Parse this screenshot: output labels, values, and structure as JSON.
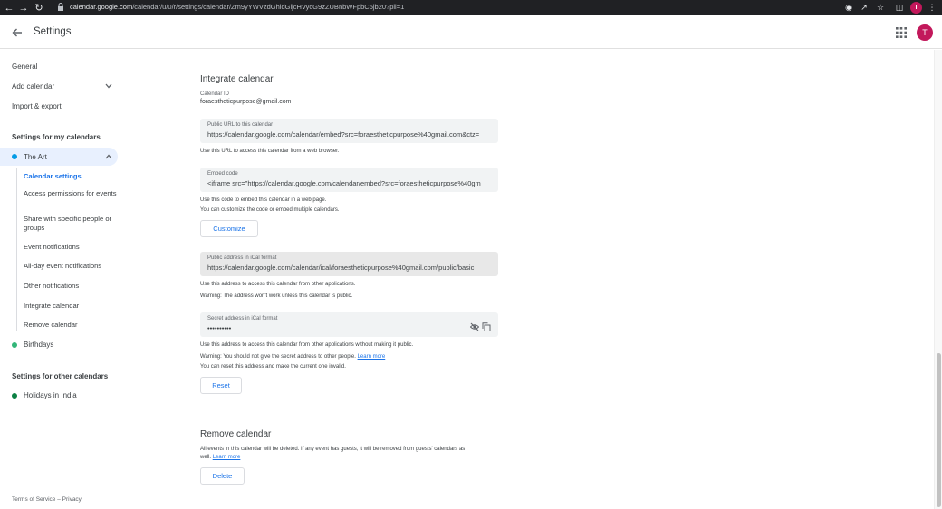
{
  "browser": {
    "url_host": "calendar.google.com",
    "url_path": "/calendar/u/0/r/settings/calendar/Zm9yYWVzdGhldGljcHVycG9zZUBnbWFpbC5jb20?pli=1",
    "profile_initial": "T"
  },
  "header": {
    "title": "Settings",
    "avatar_initial": "T"
  },
  "sidebar": {
    "general": "General",
    "add_calendar": "Add calendar",
    "import_export": "Import & export",
    "my_calendars_heading": "Settings for my calendars",
    "the_art": "The Art",
    "sub_items": [
      "Calendar settings",
      "Access permissions for events",
      "Share with specific people or groups",
      "Event notifications",
      "All-day event notifications",
      "Other notifications",
      "Integrate calendar",
      "Remove calendar"
    ],
    "birthdays": "Birthdays",
    "other_calendars_heading": "Settings for other calendars",
    "holidays": "Holidays in India",
    "footer": "Terms of Service – Privacy"
  },
  "colors": {
    "the_art_dot": "#039be5",
    "birthdays_dot": "#33b679",
    "holidays_dot": "#0b8043",
    "accent": "#1a73e8"
  },
  "integrate": {
    "title": "Integrate calendar",
    "calendar_id_label": "Calendar ID",
    "calendar_id": "foraestheticpurpose@gmail.com",
    "public_url_label": "Public URL to this calendar",
    "public_url": "https://calendar.google.com/calendar/embed?src=foraestheticpurpose%40gmail.com&ctz=",
    "public_url_help": "Use this URL to access this calendar from a web browser.",
    "embed_label": "Embed code",
    "embed_value": "<iframe src=\"https://calendar.google.com/calendar/embed?src=foraestheticpurpose%40gm",
    "embed_help_1": "Use this code to embed this calendar in a web page.",
    "embed_help_2": "You can customize the code or embed multiple calendars.",
    "customize_button": "Customize",
    "ical_public_label": "Public address in iCal format",
    "ical_public_value": "https://calendar.google.com/calendar/ical/foraestheticpurpose%40gmail.com/public/basic",
    "ical_public_help_1": "Use this address to access this calendar from other applications.",
    "ical_public_help_2": "Warning: The address won't work unless this calendar is public.",
    "ical_secret_label": "Secret address in iCal format",
    "ical_secret_value": "••••••••••",
    "ical_secret_help_1": "Use this address to access this calendar from other applications without making it public.",
    "ical_secret_help_2": "Warning: You should not give the secret address to other people.",
    "learn_more": "Learn more",
    "ical_secret_help_3": "You can reset this address and make the current one invalid.",
    "reset_button": "Reset"
  },
  "remove": {
    "title": "Remove calendar",
    "help_1": "All events in this calendar will be deleted. If any event has guests, it will be removed from guests' calendars as",
    "help_2_prefix": "well.",
    "learn_more": "Learn more",
    "delete_button": "Delete"
  }
}
